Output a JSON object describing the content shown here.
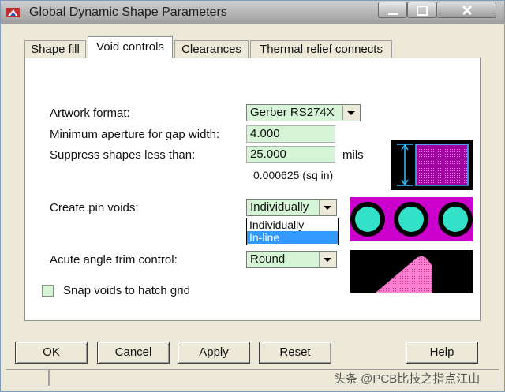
{
  "window": {
    "title": "Global Dynamic Shape Parameters",
    "title_bar_color": "#b8b8b8",
    "icon": "app-icon"
  },
  "tabs": [
    {
      "label": "Shape fill",
      "active": false
    },
    {
      "label": "Void controls",
      "active": true
    },
    {
      "label": "Clearances",
      "active": false
    },
    {
      "label": "Thermal relief connects",
      "active": false
    }
  ],
  "void_controls": {
    "artwork_format": {
      "label": "Artwork format:",
      "value": "Gerber RS274X"
    },
    "min_aperture": {
      "label": "Minimum aperture for gap width:",
      "value": "4.000"
    },
    "suppress_shapes": {
      "label": "Suppress shapes less than:",
      "value": "25.000",
      "unit": "mils",
      "area_text": "0.000625 (sq in)"
    },
    "create_pin_voids": {
      "label": "Create pin voids:",
      "value": "Individually",
      "options": [
        "Individually",
        "In-line"
      ],
      "highlighted_option": "In-line"
    },
    "acute_angle_trim": {
      "label": "Acute angle trim control:",
      "value": "Round"
    },
    "snap_voids": {
      "label": "Snap voids to hatch grid",
      "checked": false
    }
  },
  "colors": {
    "field_bg": "#d6f5d6",
    "preview_magenta": "#cc00cc",
    "preview_cyan": "#33e0c8",
    "preview_pink": "#ff7fd0",
    "selection_blue": "#3399ff"
  },
  "buttons": {
    "ok": "OK",
    "cancel": "Cancel",
    "apply": "Apply",
    "reset": "Reset",
    "help": "Help"
  },
  "watermark": "头条 @PCB比技之指点江山"
}
